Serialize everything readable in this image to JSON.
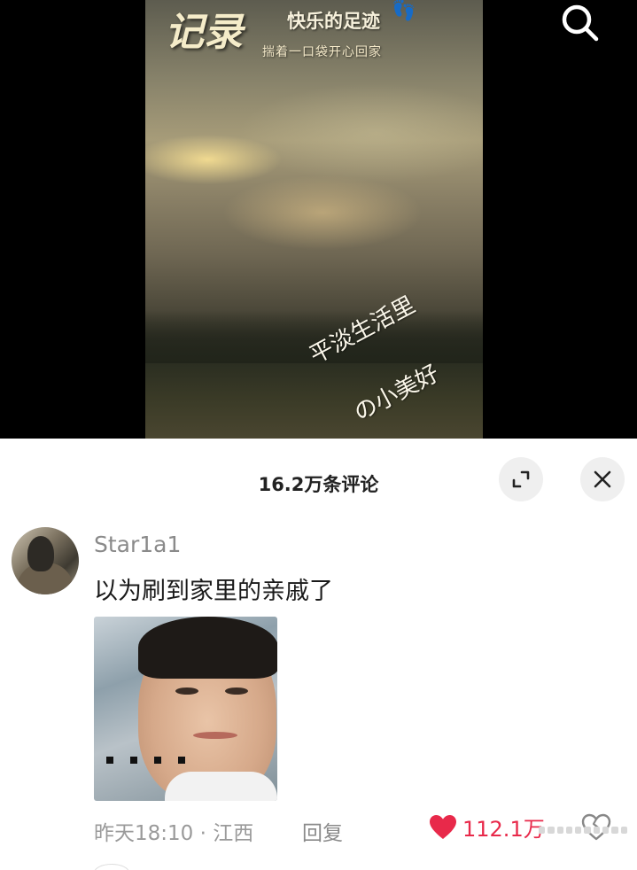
{
  "video": {
    "title_big": "记录",
    "title_small": "快乐的足迹",
    "subtitle": "揣着一口袋开心回家",
    "handwrite_line1": "平淡生活里",
    "handwrite_line2": "の小美好",
    "search_icon": "search-icon"
  },
  "comments_header": {
    "title": "16.2万条评论",
    "expand_icon": "expand-icon",
    "close_icon": "close-icon"
  },
  "comment": {
    "username": "Star1a1",
    "text": "以为刷到家里的亲戚了",
    "time_location": "昨天18:10 · 江西",
    "reply_label": "回复",
    "like_count": "112.1万",
    "like_color": "#e8294a",
    "like_icon": "heart-icon",
    "dislike_icon": "broken-heart-icon"
  }
}
